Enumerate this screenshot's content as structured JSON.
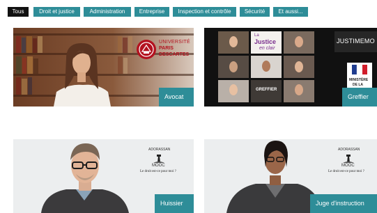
{
  "filters": [
    {
      "label": "Tous",
      "active": true
    },
    {
      "label": "Droit et justice",
      "active": false
    },
    {
      "label": "Administration",
      "active": false
    },
    {
      "label": "Entreprise",
      "active": false
    },
    {
      "label": "Inspection et contrôle",
      "active": false
    },
    {
      "label": "Sécurité",
      "active": false
    },
    {
      "label": "Et aussi...",
      "active": false
    }
  ],
  "cards": {
    "avocat": {
      "label": "Avocat",
      "logo_line1": "UNIVERSITÉ",
      "logo_line2": "PARIS",
      "logo_line3": "DESCARTES"
    },
    "greffier": {
      "label": "Greffier",
      "brand_top": "La",
      "brand_main": "Justice",
      "brand_sub": "en clair",
      "tile_label": "GREFFIER",
      "right_brand": "JUSTIMEMO",
      "ministry_line1": "MINISTÈRE",
      "ministry_line2": "DE LA"
    },
    "huissier": {
      "label": "Huissier",
      "mooc_top": "ADORASSAN",
      "mooc_name": "MOOC",
      "mooc_tagline": "Le droit est-ce pour moi ?"
    },
    "juge": {
      "label": "Juge d'instruction",
      "mooc_top": "ADORASSAN",
      "mooc_name": "MOOC",
      "mooc_tagline": "Le droit est-ce pour moi ?"
    }
  },
  "colors": {
    "accent": "#2e8d98",
    "active_filter": "#111111",
    "logo_red": "#b3121f"
  }
}
